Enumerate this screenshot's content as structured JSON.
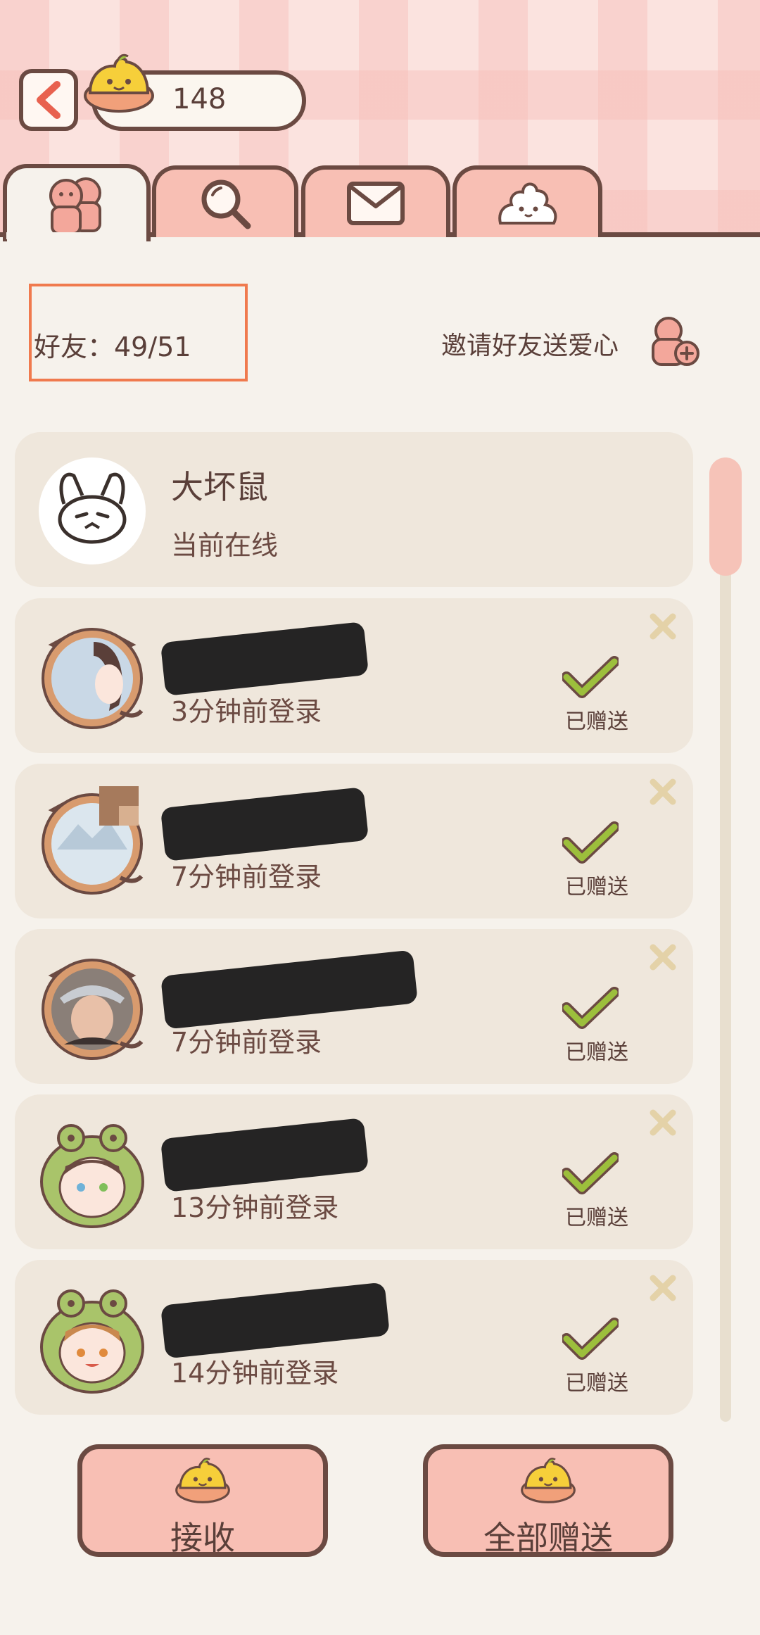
{
  "header": {
    "currency_value": "148"
  },
  "tabs": [
    {
      "icon": "friends-icon",
      "active": true
    },
    {
      "icon": "search-icon",
      "active": false
    },
    {
      "icon": "mail-icon",
      "active": false
    },
    {
      "icon": "poop-mascot-icon",
      "active": false
    }
  ],
  "summary": {
    "friend_count": "好友：49/51",
    "invite_label": "邀请好友送爱心"
  },
  "friends": [
    {
      "name": "大坏鼠",
      "status": "当前在线",
      "sent": false
    },
    {
      "name": "",
      "status": "3分钟前登录",
      "sent": true,
      "sent_label": "已赠送"
    },
    {
      "name": "",
      "status": "7分钟前登录",
      "sent": true,
      "sent_label": "已赠送"
    },
    {
      "name": "",
      "status": "7分钟前登录",
      "sent": true,
      "sent_label": "已赠送"
    },
    {
      "name": "",
      "status": "13分钟前登录",
      "sent": true,
      "sent_label": "已赠送"
    },
    {
      "name": "",
      "status": "14分钟前登录",
      "sent": true,
      "sent_label": "已赠送"
    }
  ],
  "actions": {
    "receive_label": "接收",
    "send_all_label": "全部赠送"
  },
  "colors": {
    "accent_pink": "#f8bfb4",
    "outline_brown": "#6b4a42",
    "check_green": "#9cbf3c",
    "highlight_orange": "#f07a4e"
  }
}
